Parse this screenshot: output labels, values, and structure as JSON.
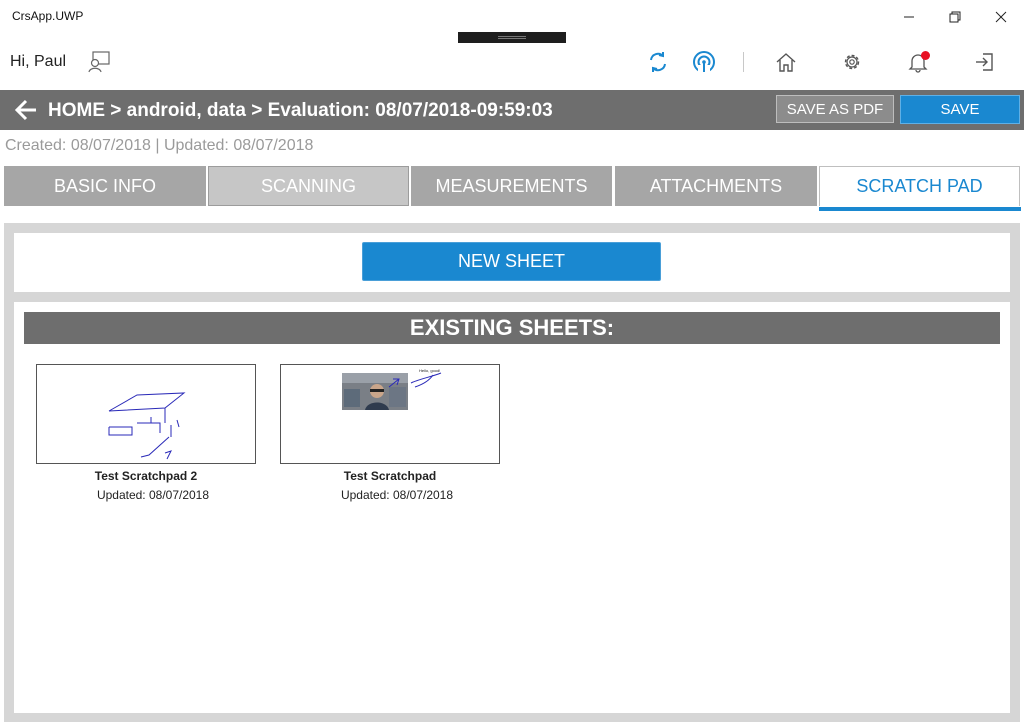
{
  "window": {
    "title": "CrsApp.UWP"
  },
  "header": {
    "greeting": "Hi, Paul"
  },
  "breadcrumb": {
    "text": "HOME > android, data > Evaluation: 08/07/2018-09:59:03"
  },
  "actions": {
    "save_pdf": "SAVE AS PDF",
    "save": "SAVE"
  },
  "meta": {
    "dates": "Created: 08/07/2018  | Updated: 08/07/2018"
  },
  "tabs": [
    {
      "label": "BASIC INFO"
    },
    {
      "label": "SCANNING"
    },
    {
      "label": "MEASUREMENTS"
    },
    {
      "label": "ATTACHMENTS"
    },
    {
      "label": "SCRATCH PAD",
      "active": true
    }
  ],
  "new_sheet_label": "NEW SHEET",
  "existing_sheets_title": "EXISTING SHEETS:",
  "sheets": [
    {
      "title": "Test Scratchpad 2",
      "updated": "Updated:  08/07/2018"
    },
    {
      "title": "Test Scratchpad",
      "updated": "Updated:  08/07/2018",
      "thumb_note": "Hello, good!"
    }
  ],
  "colors": {
    "accent": "#1a88d0",
    "bar": "#6e6e6e",
    "notification": "#e81123"
  }
}
